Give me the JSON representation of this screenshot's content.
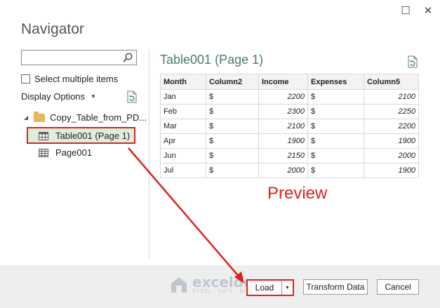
{
  "window": {
    "title": "Navigator",
    "maximize_glyph": "☐",
    "close_glyph": "✕"
  },
  "left": {
    "search": {
      "value": "",
      "placeholder": ""
    },
    "select_multiple_label": "Select multiple items",
    "display_options_label": "Display Options",
    "tree": {
      "folder_label": "Copy_Table_from_PD...",
      "items": [
        {
          "label": "Table001 (Page 1)",
          "selected": true
        },
        {
          "label": "Page001",
          "selected": false
        }
      ]
    }
  },
  "preview": {
    "title": "Table001 (Page 1)",
    "columns": [
      "Month",
      "Column2",
      "Income",
      "Expenses",
      "Column5"
    ],
    "rows": [
      [
        "Jan",
        "$",
        "2200",
        "$",
        "2100"
      ],
      [
        "Feb",
        "$",
        "2300",
        "$",
        "2250"
      ],
      [
        "Mar",
        "$",
        "2100",
        "$",
        "2200"
      ],
      [
        "Apr",
        "$",
        "1900",
        "$",
        "1900"
      ],
      [
        "Jun",
        "$",
        "2150",
        "$",
        "2000"
      ],
      [
        "Jul",
        "$",
        "2000",
        "$",
        "1900"
      ]
    ]
  },
  "annotation": {
    "label": "Preview",
    "color": "#e02020"
  },
  "footer": {
    "load_label": "Load",
    "transform_label": "Transform Data",
    "cancel_label": "Cancel"
  },
  "watermark": {
    "main": "exceldemy",
    "sub": "EXCEL · DATA · BI"
  }
}
